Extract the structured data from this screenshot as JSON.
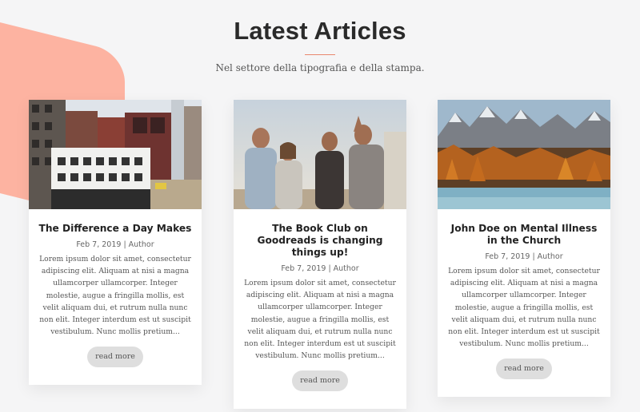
{
  "section": {
    "title": "Latest Articles",
    "subtitle": "Nel settore della tipografia e della stampa."
  },
  "accent_color": "#e9866e",
  "decor_color": "#fdb3a1",
  "articles": [
    {
      "image": "city-buildings-photo",
      "title": "The Difference a Day Makes",
      "date": "Feb 7, 2019",
      "separator": "|",
      "author": "Author",
      "excerpt": "Lorem ipsum dolor sit amet, consectetur adipiscing elit. Aliquam at nisi a magna ullamcorper ullamcorper. Integer molestie, augue a fringilla mollis, est velit aliquam dui, et rutrum nulla nunc non elit. Integer interdum est ut suscipit vestibulum. Nunc mollis pretium...",
      "button": "read more"
    },
    {
      "image": "friends-group-photo",
      "title": "The Book Club on Goodreads is changing things up!",
      "date": "Feb 7, 2019",
      "separator": "|",
      "author": "Author",
      "excerpt": "Lorem ipsum dolor sit amet, consectetur adipiscing elit. Aliquam at nisi a magna ullamcorper ullamcorper. Integer molestie, augue a fringilla mollis, est velit aliquam dui, et rutrum nulla nunc non elit. Integer interdum est ut suscipit vestibulum. Nunc mollis pretium...",
      "button": "read more"
    },
    {
      "image": "mountain-lake-photo",
      "title": "John Doe on Mental Illness in the Church",
      "date": "Feb 7, 2019",
      "separator": "|",
      "author": "Author",
      "excerpt": "Lorem ipsum dolor sit amet, consectetur adipiscing elit. Aliquam at nisi a magna ullamcorper ullamcorper. Integer molestie, augue a fringilla mollis, est velit aliquam dui, et rutrum nulla nunc non elit. Integer interdum est ut suscipit vestibulum. Nunc mollis pretium...",
      "button": "read more"
    }
  ]
}
